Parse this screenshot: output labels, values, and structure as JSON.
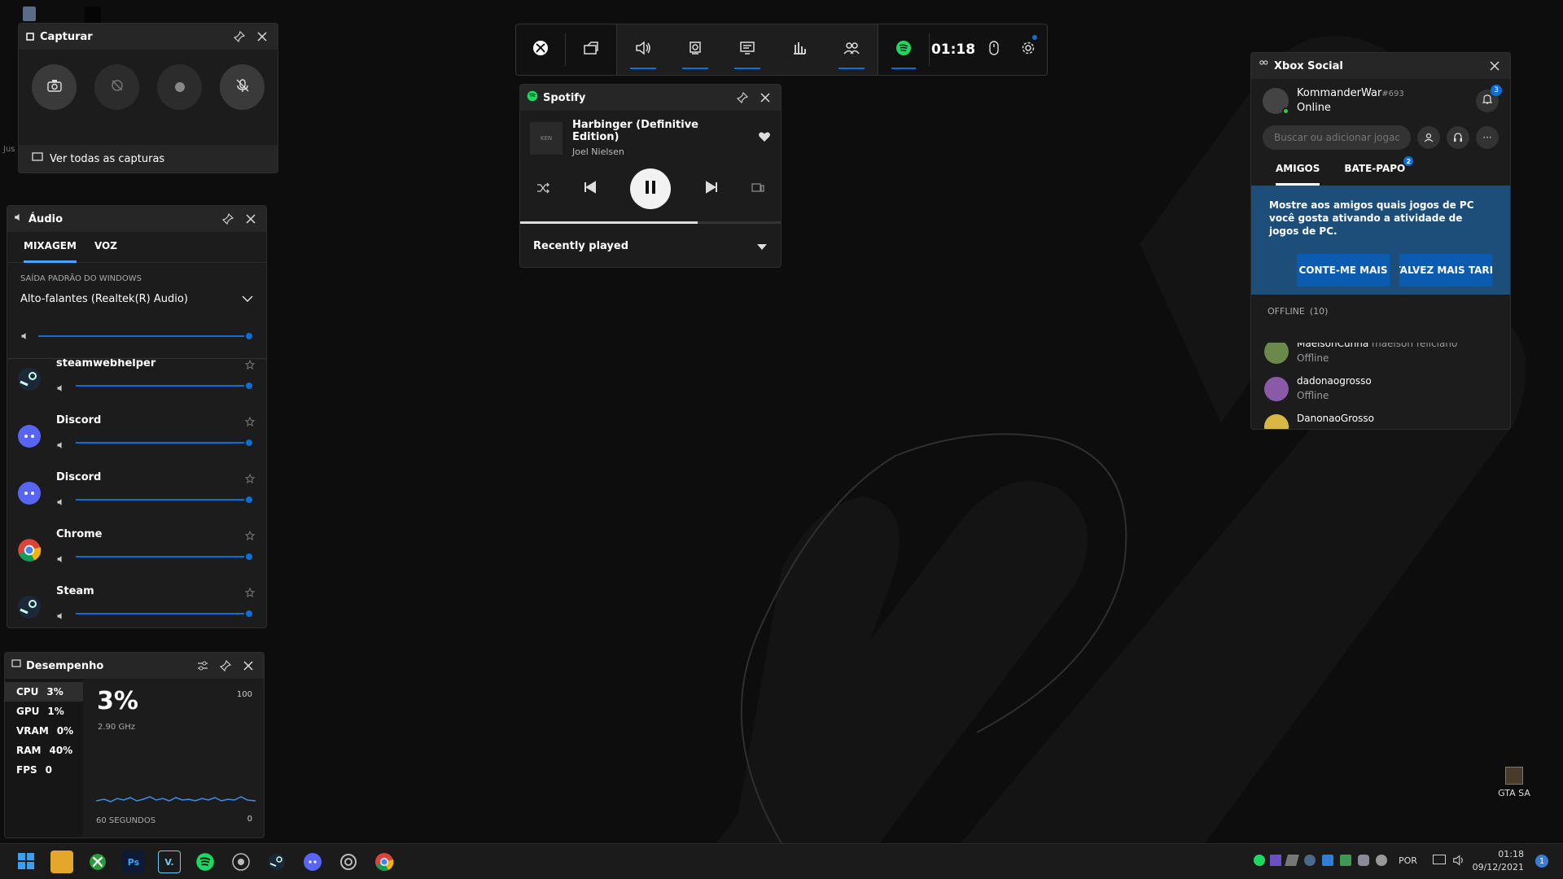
{
  "capture": {
    "title": "Capturar",
    "view_all": "Ver todas as capturas",
    "buttons": [
      "screenshot",
      "record-last",
      "record",
      "mic-off"
    ]
  },
  "gamebar": {
    "time": "01:18",
    "items": [
      "xbox",
      "widget-menu",
      "audio",
      "capture",
      "resources",
      "performance",
      "social",
      "spotify"
    ]
  },
  "spotify": {
    "title": "Spotify",
    "track": "Harbinger (Definitive Edition)",
    "artist": "Joel Nielsen",
    "album_art_text": "KEN",
    "recently_played": "Recently played",
    "progress": 0.68
  },
  "audio": {
    "title": "Áudio",
    "tabs": [
      "MIXAGEM",
      "VOZ"
    ],
    "section_label": "SAÍDA PADRÃO DO WINDOWS",
    "device": "Alto-falantes (Realtek(R) Audio)",
    "apps": [
      {
        "name": "steamwebhelper",
        "icon": "steam"
      },
      {
        "name": "Discord",
        "icon": "discord"
      },
      {
        "name": "Discord",
        "icon": "discord"
      },
      {
        "name": "Chrome",
        "icon": "chrome"
      },
      {
        "name": "Steam",
        "icon": "steam"
      }
    ]
  },
  "performance": {
    "title": "Desempenho",
    "metrics": [
      {
        "label": "CPU",
        "value": "3%"
      },
      {
        "label": "GPU",
        "value": "1%"
      },
      {
        "label": "VRAM",
        "value": "0%"
      },
      {
        "label": "RAM",
        "value": "40%"
      },
      {
        "label": "FPS",
        "value": "0"
      }
    ],
    "big_value": "3%",
    "freq": "2.90 GHz",
    "max": "100",
    "min": "0",
    "span_label": "60 SEGUNDOS"
  },
  "social": {
    "title": "Xbox Social",
    "username": "KommanderWar",
    "tag": "#693",
    "status": "Online",
    "notif_count": "3",
    "search_placeholder": "Buscar ou adicionar jogado",
    "tabs": [
      "AMIGOS",
      "BATE-PAPO"
    ],
    "chat_badge": "2",
    "promo_text": "Mostre aos amigos quais jogos de PC você gosta ativando a atividade de jogos de PC.",
    "btn_more": "CONTE-ME MAIS",
    "btn_later": "TALVEZ MAIS TARD",
    "offline_header": "OFFLINE",
    "offline_count": "(10)",
    "friends": [
      {
        "name": "MaelsonCunha",
        "real": "maelson feliciano",
        "status": "Offline"
      },
      {
        "name": "dadonaogrosso",
        "real": "",
        "status": "Offline"
      },
      {
        "name": "DanonaoGrosso",
        "real": "",
        "status": ""
      }
    ]
  },
  "desktop": {
    "gta_label": "GTA SA",
    "left_hint": "Jus"
  },
  "taskbar": {
    "lang": "POR",
    "time": "01:18",
    "date": "09/12/2021",
    "notif": "1"
  }
}
